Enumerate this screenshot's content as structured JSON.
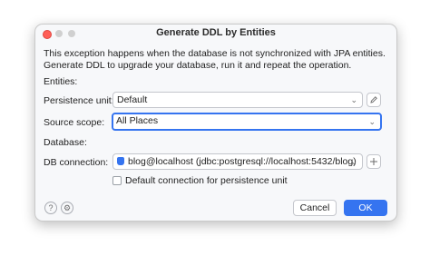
{
  "window": {
    "title": "Generate DDL by Entities"
  },
  "message": {
    "line1": "This exception happens when the database is not synchronized with JPA entities.",
    "line2": "Generate DDL to upgrade your database, run it and repeat the operation."
  },
  "entities": {
    "section_label": "Entities:",
    "persistence_unit_label": "Persistence unit:",
    "persistence_unit_value": "Default",
    "source_scope_label": "Source scope:",
    "source_scope_value": "All Places"
  },
  "database": {
    "section_label": "Database:",
    "connection_label": "DB connection:",
    "connection_value": "blog@localhost (jdbc:postgresql://localhost:5432/blog)",
    "default_checkbox_label": "Default connection for persistence unit",
    "default_checkbox_checked": false
  },
  "footer": {
    "help_icon_glyph": "?",
    "settings_icon_glyph": "⚙",
    "cancel_label": "Cancel",
    "ok_label": "OK"
  },
  "icons": {
    "edit": "pencil-icon",
    "add": "plus-icon",
    "db": "postgresql-icon"
  },
  "colors": {
    "accent": "#3574f0",
    "close_light": "#ff5f57"
  }
}
